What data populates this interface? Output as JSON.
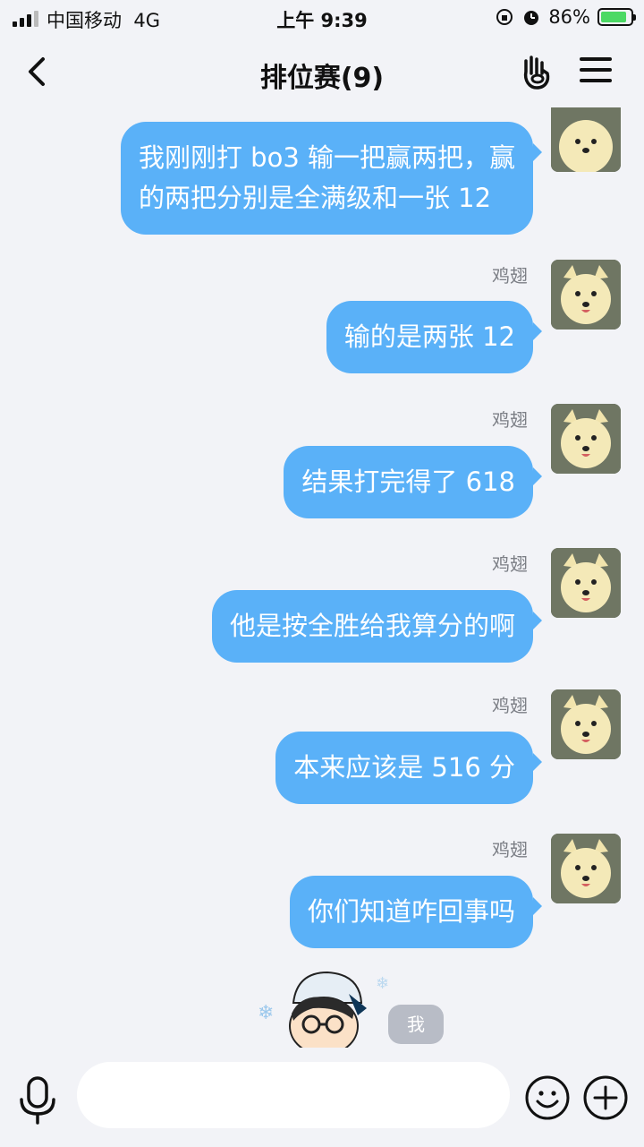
{
  "status": {
    "carrier": "中国移动",
    "network": "4G",
    "time": "上午 9:39",
    "battery": "86%",
    "battery_level": 0.86
  },
  "header": {
    "title": "排位赛(9)",
    "back_icon": "chevron-left-icon",
    "gesture_icon": "hand-gesture-icon",
    "menu_icon": "hamburger-menu-icon"
  },
  "messages": [
    {
      "sender": "",
      "text_lines": [
        "我刚刚打 bo3 输一把赢两把，赢",
        "的两把分别是全满级和一张 12"
      ]
    },
    {
      "sender": "鸡翅",
      "text": "输的是两张 12"
    },
    {
      "sender": "鸡翅",
      "text": "结果打完得了 618"
    },
    {
      "sender": "鸡翅",
      "text": "他是按全胜给我算分的啊"
    },
    {
      "sender": "鸡翅",
      "text": "本来应该是 516 分"
    },
    {
      "sender": "鸡翅",
      "text": "你们知道咋回事吗"
    }
  ],
  "self_badge": "我",
  "input": {
    "placeholder": "",
    "value": "",
    "mic_icon": "microphone-icon",
    "emoji_icon": "smiley-icon",
    "plus_icon": "plus-circle-icon"
  }
}
